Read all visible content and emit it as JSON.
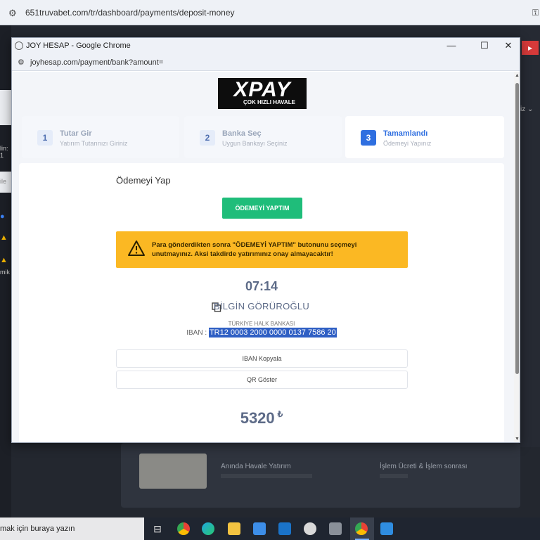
{
  "background": {
    "address_url": "651truvabet.com/tr/dashboard/payments/deposit-money",
    "left_snippets": [
      "lin: 1",
      "ile",
      "mik"
    ],
    "right_text": "iz",
    "card_titles": [
      "Anında Havale Yatırım",
      "İşlem Ücreti & İşlem sonrası"
    ]
  },
  "popup": {
    "window_title": "JOY HESAP - Google Chrome",
    "url": "joyhesap.com/payment/bank?amount=",
    "controls": {
      "minimize": "—",
      "maximize": "☐",
      "close": "✕"
    }
  },
  "logo": {
    "main": "XPAY",
    "sub": "ÇOK HIZLI HAVALE"
  },
  "steps": [
    {
      "number": "1",
      "title": "Tutar Gir",
      "desc": "Yatırım Tutarınızı Giriniz",
      "active": false
    },
    {
      "number": "2",
      "title": "Banka Seç",
      "desc": "Uygun Bankayı Seçiniz",
      "active": false
    },
    {
      "number": "3",
      "title": "Tamamlandı",
      "desc": "Ödemeyi Yapınız",
      "active": true
    }
  ],
  "payment": {
    "section_title": "Ödemeyi Yap",
    "paid_button": "ÖDEMEYİ YAPTIM",
    "warning": "Para gönderdikten sonra \"ÖDEMEYİ YAPTIM\" butonunu seçmeyi unutmayınız. Aksi takdirde yatırımınız onay almayacaktır!",
    "timer": "07:14",
    "account_holder": "BİLGİN GÖRÜROĞLU",
    "bank_name": "TÜRKİYE HALK BANKASI",
    "iban_label": "IBAN :",
    "iban": "TR12 0003 2000 0000 0137 7586 20",
    "copy_iban_button": "IBAN Kopyala",
    "qr_button": "QR Göster",
    "amount": "5320",
    "currency": "₺"
  },
  "taskbar": {
    "search_text": "mak için buraya yazın",
    "icons": [
      "task-view-icon",
      "chrome-icon",
      "edge-icon",
      "file-explorer-icon",
      "store-icon",
      "outlook-icon",
      "paint-icon",
      "calculator-icon",
      "chrome-active-icon",
      "photos-icon"
    ]
  },
  "colors": {
    "accent_blue": "#2f6fe0",
    "button_green": "#1fbd7a",
    "warning_yellow": "#fbb823",
    "iban_highlight": "#2f5fc4"
  }
}
